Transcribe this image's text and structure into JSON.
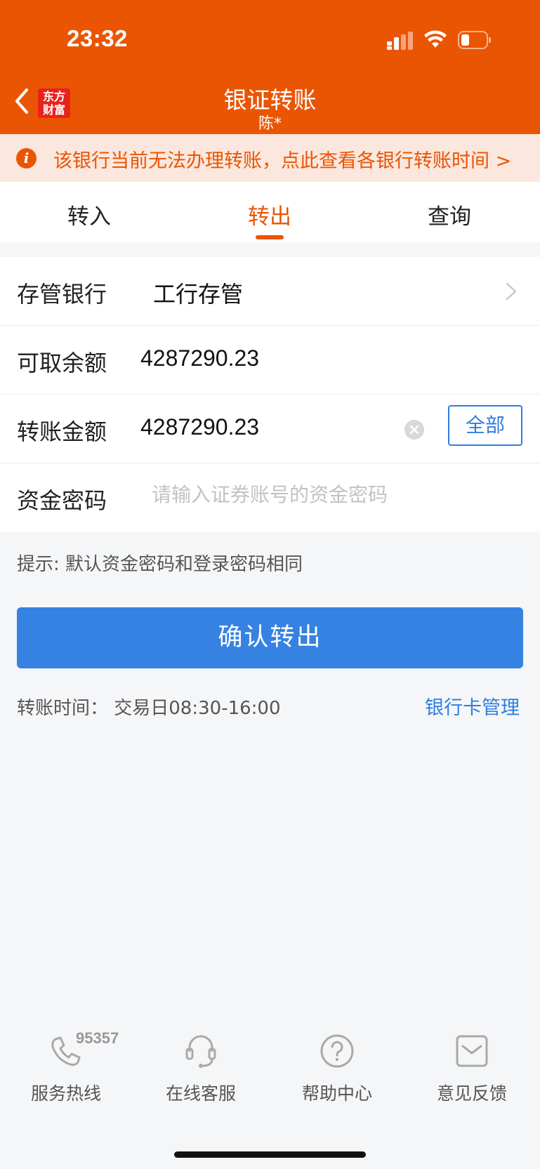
{
  "status_bar": {
    "time": "23:32"
  },
  "header": {
    "title": "银证转账",
    "subtitle": "陈*",
    "logo_text": "东方财富"
  },
  "notice": {
    "text": "该银行当前无法办理转账，点此查看各银行转账时间 >"
  },
  "tabs": [
    {
      "label": "转入",
      "active": false
    },
    {
      "label": "转出",
      "active": true
    },
    {
      "label": "查询",
      "active": false
    }
  ],
  "form": {
    "bank": {
      "label": "存管银行",
      "value": "工行存管"
    },
    "balance": {
      "label": "可取余额",
      "value": "4287290.23"
    },
    "amount": {
      "label": "转账金额",
      "value": "4287290.23",
      "all_label": "全部"
    },
    "password": {
      "label": "资金密码",
      "placeholder": "请输入证券账号的资金密码"
    }
  },
  "hint": "提示: 默认资金密码和登录密码相同",
  "confirm_button": "确认转出",
  "transfer_time": "转账时间：  交易日08:30-16:00",
  "bank_card_mgmt": "银行卡管理",
  "footer": {
    "hotline_number": "95357",
    "items": [
      {
        "label": "服务热线",
        "icon": "phone-icon"
      },
      {
        "label": "在线客服",
        "icon": "headset-icon"
      },
      {
        "label": "帮助中心",
        "icon": "help-icon"
      },
      {
        "label": "意见反馈",
        "icon": "mail-icon"
      }
    ]
  },
  "colors": {
    "brand_orange": "#ea5504",
    "primary_blue": "#3582e3",
    "link_blue": "#2f7de1"
  }
}
